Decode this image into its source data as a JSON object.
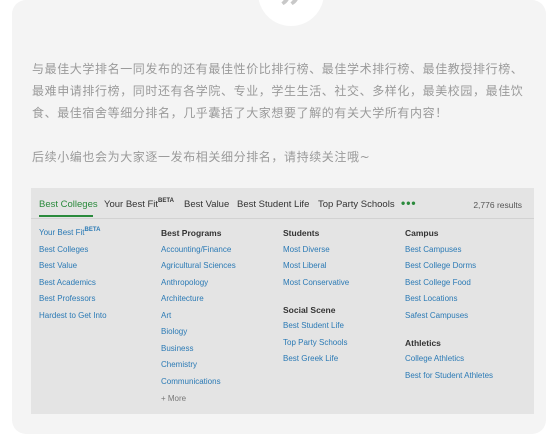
{
  "article": {
    "quote_mark": "”",
    "paragraph1": "与最佳大学排名一同发布的还有最佳性价比排行榜、最佳学术排行榜、最佳教授排行榜、最难申请排行榜，同时还有各学院、专业，学生生活、社交、多样化，最美校园，最佳饮食、最佳宿舍等细分排名，几乎囊括了大家想要了解的有关大学所有内容！",
    "paragraph2": "后续小编也会为大家逐一发布相关细分排名，请持续关注哦~"
  },
  "nav": {
    "tabs": [
      {
        "label": "Best Colleges",
        "active": true
      },
      {
        "label": "Your Best Fit",
        "sup": "BETA"
      },
      {
        "label": "Best Value"
      },
      {
        "label": "Best Student Life"
      },
      {
        "label": "Top Party Schools"
      }
    ],
    "more_dots": "•••",
    "results": "2,776 results",
    "accent_color": "#2a8a3c",
    "link_color": "#2b7ab5"
  },
  "menu": {
    "col1": {
      "links": [
        "Your Best Fit",
        "Best Colleges",
        "Best Value",
        "Best Academics",
        "Best Professors",
        "Hardest to Get Into"
      ],
      "beta": "BETA"
    },
    "col2": {
      "heading": "Best Programs",
      "links": [
        "Accounting/Finance",
        "Agricultural Sciences",
        "Anthropology",
        "Architecture",
        "Art",
        "Biology",
        "Business",
        "Chemistry",
        "Communications"
      ],
      "more": "+ More"
    },
    "col3": {
      "heading1": "Students",
      "links1": [
        "Most Diverse",
        "Most Liberal",
        "Most Conservative"
      ],
      "heading2": "Social Scene",
      "links2": [
        "Best Student Life",
        "Top Party Schools",
        "Best Greek Life"
      ]
    },
    "col4": {
      "heading1": "Campus",
      "links1": [
        "Best Campuses",
        "Best College Dorms",
        "Best College Food",
        "Best Locations",
        "Safest Campuses"
      ],
      "heading2": "Athletics",
      "links2": [
        "College Athletics",
        "Best for Student Athletes"
      ]
    }
  }
}
